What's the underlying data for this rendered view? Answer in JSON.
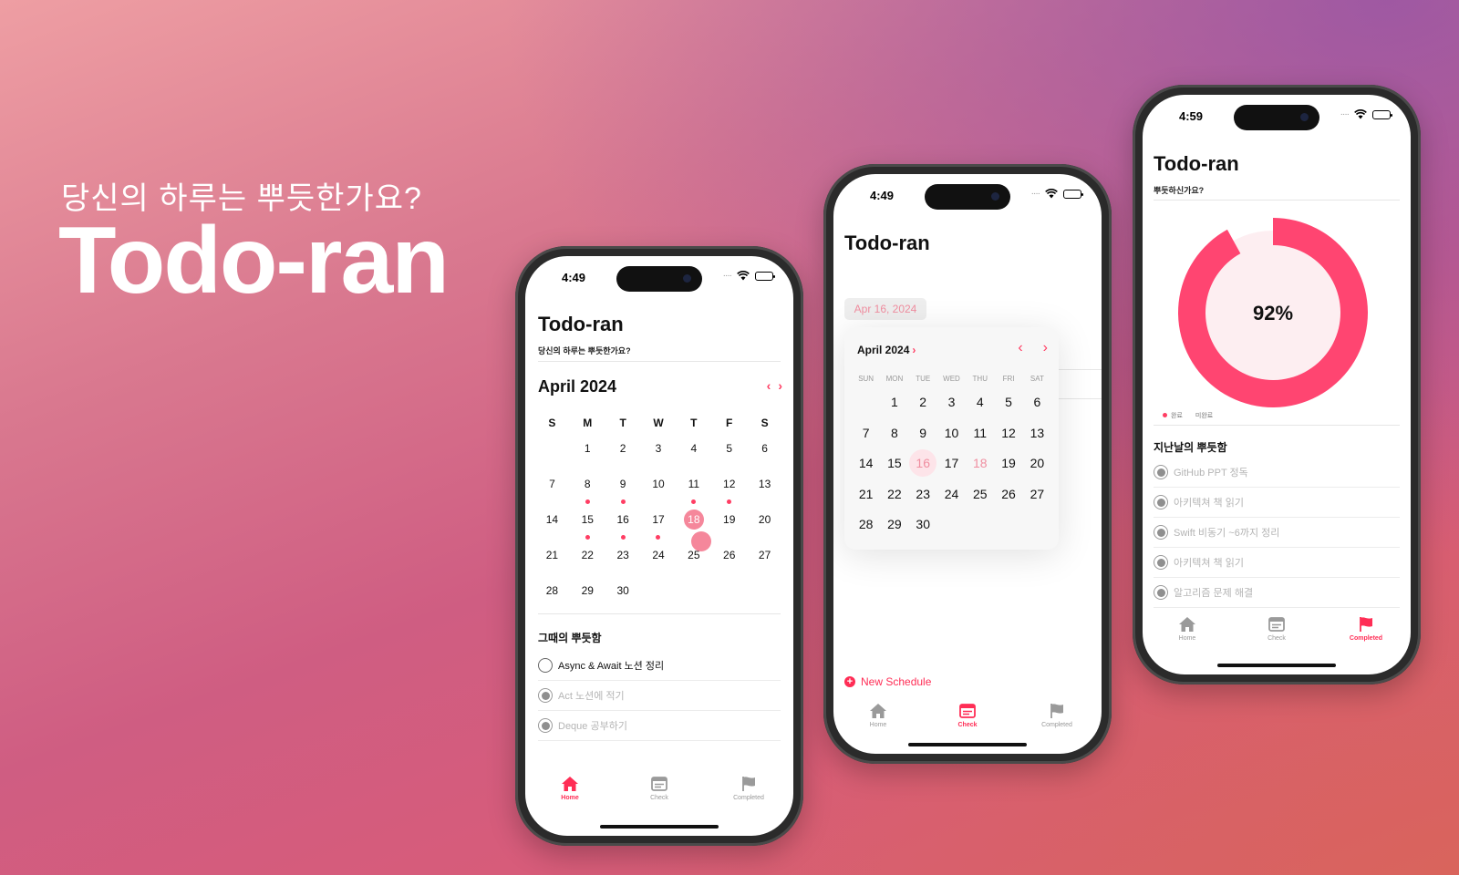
{
  "hero": {
    "subtitle": "당신의 하루는 뿌듯한가요?",
    "title": "Todo-ran"
  },
  "colors": {
    "accent": "#ff2d55",
    "accent_light": "#f5879b"
  },
  "phone1": {
    "time": "4:49",
    "app_title": "Todo-ran",
    "app_subtitle": "당신의 하루는 뿌듯한가요?",
    "month_title": "April 2024",
    "nav_prev": "‹",
    "nav_next": "›",
    "weekdays": [
      "S",
      "M",
      "T",
      "W",
      "T",
      "F",
      "S"
    ],
    "days": [
      "",
      "1",
      "2",
      "3",
      "4",
      "5",
      "6",
      "7",
      "8",
      "9",
      "10",
      "11",
      "12",
      "13",
      "14",
      "15",
      "16",
      "17",
      "18",
      "19",
      "20",
      "21",
      "22",
      "23",
      "24",
      "25",
      "26",
      "27",
      "28",
      "29",
      "30"
    ],
    "days_with_tasks": [
      "8",
      "9",
      "11",
      "12",
      "15",
      "16",
      "17",
      "18"
    ],
    "selected_day": "18",
    "section_title": "그때의 뿌듯함",
    "tasks": [
      {
        "label": "Async & Await 노션 정리",
        "done": false
      },
      {
        "label": "Act 노션에 적기",
        "done": true
      },
      {
        "label": "Deque 공부하기",
        "done": true
      }
    ],
    "tabs": [
      {
        "label": "Home",
        "icon": "house-icon",
        "active": true
      },
      {
        "label": "Check",
        "icon": "checklist-icon",
        "active": false
      },
      {
        "label": "Completed",
        "icon": "flag-icon",
        "active": false
      }
    ]
  },
  "phone2": {
    "time": "4:49",
    "app_title": "Todo-ran",
    "date_chip": "Apr 16, 2024",
    "popover_title": "April 2024",
    "popover_chevron": "›",
    "nav_prev": "‹",
    "nav_next": "›",
    "weekdays": [
      "SUN",
      "MON",
      "TUE",
      "WED",
      "THU",
      "FRI",
      "SAT"
    ],
    "days": [
      "",
      "1",
      "2",
      "3",
      "4",
      "5",
      "6",
      "7",
      "8",
      "9",
      "10",
      "11",
      "12",
      "13",
      "14",
      "15",
      "16",
      "17",
      "18",
      "19",
      "20",
      "21",
      "22",
      "23",
      "24",
      "25",
      "26",
      "27",
      "28",
      "29",
      "30"
    ],
    "selected_day": "16",
    "today_day": "18",
    "new_schedule": "New Schedule",
    "new_schedule_icon": "+",
    "tabs": [
      {
        "label": "Home",
        "icon": "house-icon",
        "active": false
      },
      {
        "label": "Check",
        "icon": "checklist-icon",
        "active": true
      },
      {
        "label": "Completed",
        "icon": "flag-icon",
        "active": false
      }
    ]
  },
  "phone3": {
    "time": "4:59",
    "app_title": "Todo-ran",
    "app_subtitle": "뿌듯하신가요?",
    "progress_label": "92%",
    "progress_value": 0.92,
    "legend": [
      "완료",
      "미완료"
    ],
    "section_title": "지난날의 뿌듯함",
    "tasks": [
      {
        "label": "GitHub PPT 정독",
        "done": true
      },
      {
        "label": "아키텍쳐 책 읽기",
        "done": true
      },
      {
        "label": "Swift 비동기 ~6까지 정리",
        "done": true
      },
      {
        "label": "아키텍쳐 책 읽기",
        "done": true
      },
      {
        "label": "알고리즘 문제 해결",
        "done": true
      }
    ],
    "tabs": [
      {
        "label": "Home",
        "icon": "house-icon",
        "active": false
      },
      {
        "label": "Check",
        "icon": "checklist-icon",
        "active": false
      },
      {
        "label": "Completed",
        "icon": "flag-icon",
        "active": true
      }
    ]
  }
}
